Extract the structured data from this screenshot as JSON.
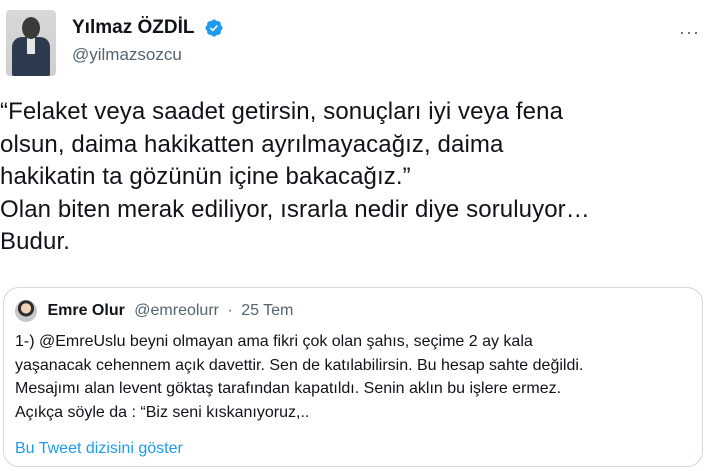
{
  "author": {
    "display_name": "Yılmaz ÖZDİL",
    "handle": "@yilmazsozcu",
    "verified_icon": "verified-badge-icon",
    "more_icon": "more-options-icon",
    "more_label": "···"
  },
  "tweet": {
    "text": "“Felaket veya saadet getirsin, sonuçları iyi veya fena\nolsun, daima hakikatten ayrılmayacağız, daima\nhakikatin ta gözünün içine bakacağız.”\nOlan biten merak ediliyor, ısrarla nedir diye soruluyor…\nBudur."
  },
  "quoted_tweet": {
    "display_name": "Emre Olur",
    "handle": "@emreolurr",
    "separator": "·",
    "date": "25 Tem",
    "text": "1-) @EmreUslu beyni olmayan ama fikri çok olan şahıs, seçime 2 ay kala\nyaşanacak cehennem açık davettir. Sen de katılabilirsin. Bu hesap sahte değildi.\nMesajımı alan levent göktaş tarafından kapatıldı. Senin aklın bu işlere ermez.\nAçıkça söyle da : “Biz seni kıskanıyoruz,..",
    "show_thread_label": "Bu Tweet dizisini göster"
  },
  "colors": {
    "text_primary": "#0f1419",
    "text_secondary": "#536471",
    "link": "#1d9bf0",
    "border": "#cfd9de",
    "verified": "#1d9bf0"
  }
}
